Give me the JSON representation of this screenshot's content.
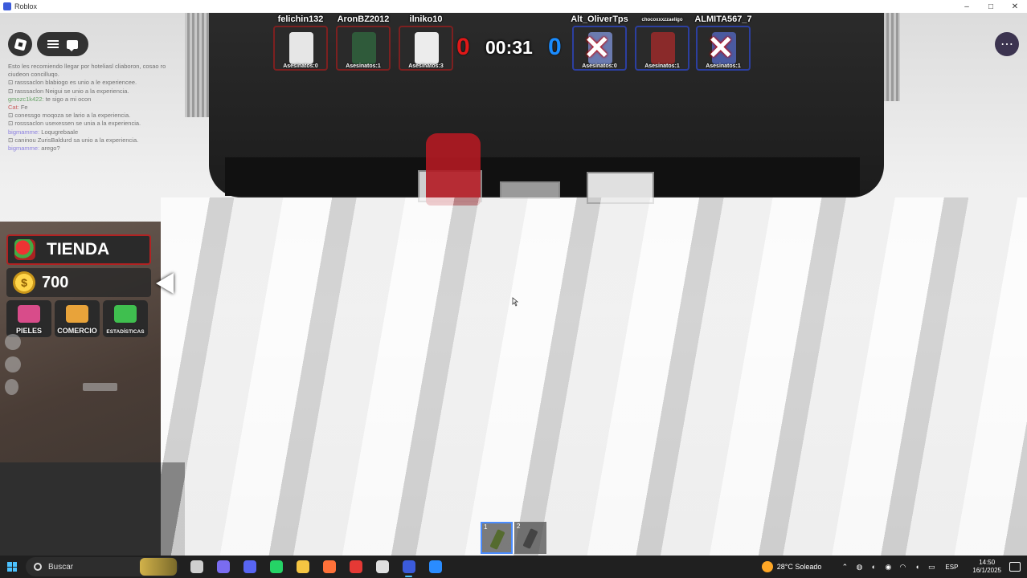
{
  "window": {
    "title": "Roblox",
    "controls": [
      "–",
      "□",
      "✕"
    ]
  },
  "scoreboard": {
    "red_team": [
      {
        "name": "felichin132",
        "kills": "Asesinatos:0",
        "avatar_color": "#e6e6e6"
      },
      {
        "name": "AronBZ2012",
        "kills": "Asesinatos:1",
        "avatar_color": "#2f5a3a"
      },
      {
        "name": "ilniko10",
        "kills": "Asesinatos:3",
        "avatar_color": "#ececec"
      }
    ],
    "red_score": "0",
    "timer": "00:31",
    "blue_score": "0",
    "blue_team": [
      {
        "name": "Alt_OliverTps",
        "kills": "Asesinatos:0",
        "eliminated": true,
        "avatar_color": "#6b7bb0"
      },
      {
        "name": "chocoxxxzzaeligo",
        "kills": "Asesinatos:1",
        "eliminated": false,
        "avatar_color": "#8a2a2a"
      },
      {
        "name": "ALMITA567_7",
        "kills": "Asesinatos:1",
        "eliminated": true,
        "avatar_color": "#4a5aa0"
      }
    ]
  },
  "chat": {
    "lines": [
      {
        "name": "",
        "text": "Esto les recomiendo llegar por hoteliasl cliaboron, cosao ro"
      },
      {
        "name": "",
        "text": "ciudeon concilluqo."
      },
      {
        "name": "",
        "text": "⊡ rasssaclon blabiogo es unio a le experiencee."
      },
      {
        "name": "",
        "text": "⊡ rasssaclon Neigui se unio a la experiencia."
      },
      {
        "name": "gmozc1k422:",
        "cls": "g",
        "text": " te sigo a mi ocon"
      },
      {
        "name": "Cat:",
        "cls": "r",
        "text": " Fe"
      },
      {
        "name": "",
        "text": "⊡ conessgo moqoza se lario a la experiencia."
      },
      {
        "name": "",
        "text": "⊡ rosssaclon usexessen se unia a la experiencia."
      },
      {
        "name": "bigmamme:",
        "cls": "",
        "text": " Loqugrebaale"
      },
      {
        "name": "",
        "text": "⊡ caninou ZurisBaldurd sa unio a la experiencia."
      },
      {
        "name": "bigmamme:",
        "cls": "",
        "text": " arego?"
      }
    ]
  },
  "left_panel": {
    "shop_label": "TIENDA",
    "coins": "700",
    "coin_symbol": "$",
    "tiles": [
      {
        "label": "PIELES",
        "icon": "skins-icon",
        "color": "#d84c8a"
      },
      {
        "label": "COMERCIO",
        "icon": "trade-icon",
        "color": "#e8a33a"
      },
      {
        "label": "ESTADÍSTICAS",
        "icon": "stats-icon",
        "color": "#3fbf4f"
      }
    ]
  },
  "hotbar": {
    "slots": [
      {
        "number": "1",
        "selected": true
      },
      {
        "number": "2",
        "selected": false
      }
    ]
  },
  "taskbar": {
    "search_placeholder": "Buscar",
    "apps": [
      {
        "name": "task-view",
        "color": "#cfcfcf"
      },
      {
        "name": "copilot",
        "color": "#7a6cf0"
      },
      {
        "name": "discord",
        "color": "#5865f2"
      },
      {
        "name": "whatsapp",
        "color": "#25d366"
      },
      {
        "name": "file-explorer",
        "color": "#f5c542"
      },
      {
        "name": "firefox",
        "color": "#ff7139"
      },
      {
        "name": "recorder",
        "color": "#e53935"
      },
      {
        "name": "notepad",
        "color": "#e0e0e0"
      },
      {
        "name": "roblox",
        "color": "#3b5bdb",
        "active": true
      },
      {
        "name": "roblox-studio",
        "color": "#2a8cff"
      }
    ],
    "weather": "28°C  Soleado",
    "language": "ESP",
    "time": "14:50",
    "date": "16/1/2025"
  }
}
